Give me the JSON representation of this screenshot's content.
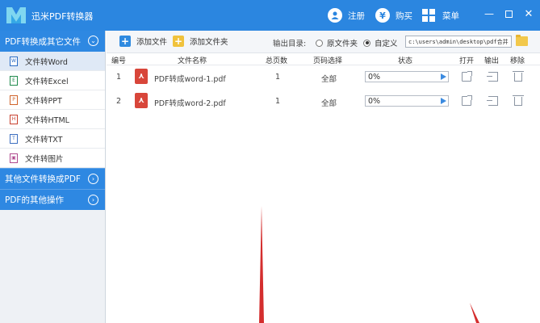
{
  "app": {
    "title": "迅米PDF转换器"
  },
  "titlebar": {
    "register_label": "注册",
    "buy_label": "购买",
    "menu_label": "菜单",
    "register_icon": "user-icon",
    "buy_icon": "yen-icon",
    "menu_icon": "grid-icon",
    "window_controls": [
      "minimize-icon",
      "maximize-icon",
      "close-icon"
    ]
  },
  "colors": {
    "titlebar_bg": "#2b86e0",
    "sidebar_header_bg": "#2e88e2",
    "pdf_icon_red": "#d8463a",
    "progress_arrow": "#3c8be0",
    "folder_yellow": "#f2c84b"
  },
  "sidebar": {
    "section1": {
      "label": "PDF转换成其它文件",
      "items": [
        {
          "label": "文件转Word",
          "icon": "word-file-icon"
        },
        {
          "label": "文件转Excel",
          "icon": "excel-file-icon"
        },
        {
          "label": "文件转PPT",
          "icon": "ppt-file-icon"
        },
        {
          "label": "文件转HTML",
          "icon": "html-file-icon"
        },
        {
          "label": "文件转TXT",
          "icon": "txt-file-icon"
        },
        {
          "label": "文件转图片",
          "icon": "image-file-icon"
        }
      ]
    },
    "section2": {
      "label": "其他文件转换成PDF"
    },
    "section3": {
      "label": "PDF的其他操作"
    }
  },
  "toolbar": {
    "add_file": "添加文件",
    "add_folder": "添加文件夹",
    "output_label": "输出目录:",
    "radio_original": "原文件夹",
    "radio_custom": "自定义",
    "selected_radio": "自定义",
    "output_path": "c:\\users\\admin\\desktop\\pdf合并"
  },
  "table": {
    "headers": [
      "编号",
      "文件名称",
      "总页数",
      "页码选择",
      "状态",
      "打开",
      "输出",
      "移除"
    ],
    "rows": [
      {
        "index": "1",
        "name": "PDF转成word-1.pdf",
        "pages": "1",
        "range": "全部",
        "status": "0%"
      },
      {
        "index": "2",
        "name": "PDF转成word-2.pdf",
        "pages": "1",
        "range": "全部",
        "status": "0%"
      }
    ]
  }
}
